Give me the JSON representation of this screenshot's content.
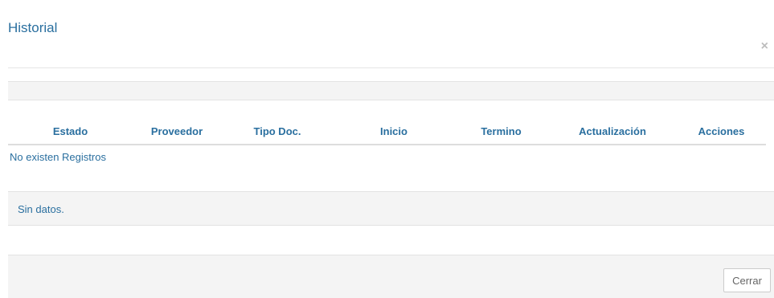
{
  "modal": {
    "title": "Historial",
    "close_glyph": "×"
  },
  "table": {
    "columns": [
      "Estado",
      "Proveedor",
      "Tipo Doc.",
      "Inicio",
      "Termino",
      "Actualización",
      "Acciones"
    ],
    "empty_message": "No existen Registros"
  },
  "footer_band": {
    "message": "Sin datos."
  },
  "footer": {
    "close_label": "Cerrar"
  },
  "colors": {
    "accent": "#2a6f9f",
    "band": "#f4f4f4"
  }
}
